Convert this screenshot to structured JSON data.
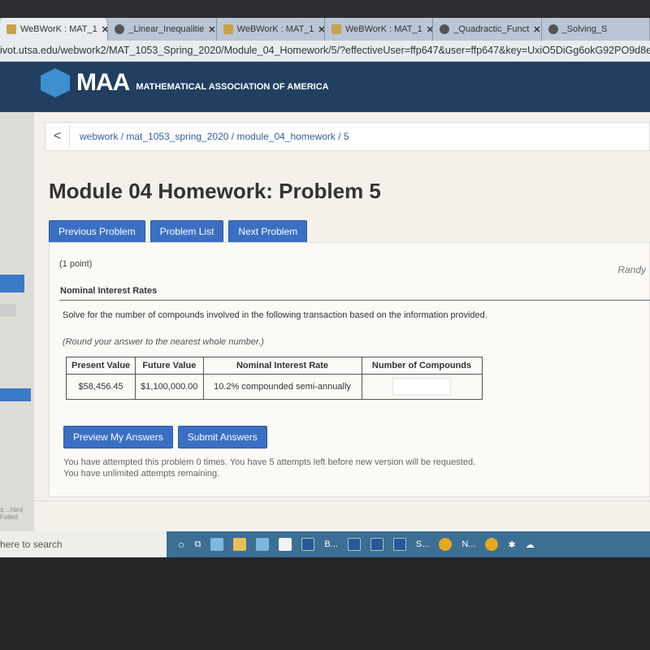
{
  "browser": {
    "tabs": [
      {
        "label": "WeBWorK : MAT_1",
        "icon": "webwork-icon",
        "active": true
      },
      {
        "label": "_Linear_Inequalitie",
        "icon": "globe-icon"
      },
      {
        "label": "WeBWorK : MAT_1",
        "icon": "webwork-icon"
      },
      {
        "label": "WeBWorK : MAT_1",
        "icon": "webwork-icon"
      },
      {
        "label": "_Quadractic_Funct",
        "icon": "globe-icon"
      },
      {
        "label": "_Solving_S",
        "icon": "globe-icon"
      }
    ],
    "close_glyph": "✕",
    "url": "ivot.utsa.edu/webwork2/MAT_1053_Spring_2020/Module_04_Homework/5/?effectiveUser=ffp647&user=ffp647&key=UxiO5DiGg6okG92PO9d8e"
  },
  "header": {
    "logo": "MAA",
    "org": "MATHEMATICAL ASSOCIATION OF AMERICA"
  },
  "breadcrumb": "webwork / mat_1053_spring_2020 / module_04_homework / 5",
  "back_glyph": "<",
  "title": "Module 04 Homework: Problem 5",
  "nav": {
    "prev": "Previous Problem",
    "list": "Problem List",
    "next": "Next Problem"
  },
  "problem": {
    "points": "(1 point)",
    "user": "Randy",
    "heading": "Nominal Interest Rates",
    "instruction": "Solve for the number of compounds involved in the following transaction based on the information provided.",
    "rounding": "(Round your answer to the nearest whole number.)",
    "table": {
      "headers": [
        "Present Value",
        "Future Value",
        "Nominal Interest Rate",
        "Number of Compounds"
      ],
      "row": [
        "$58,456.45",
        "$1,100,000.00",
        "10.2% compounded semi-annually",
        ""
      ]
    }
  },
  "actions": {
    "preview": "Preview My Answers",
    "submit": "Submit Answers"
  },
  "attempts": [
    "You have attempted this problem 0 times. You have 5 attempts left before new version will be requested.",
    "You have unlimited attempts remaining."
  ],
  "download": {
    "file": "s....html",
    "status": "Failed"
  },
  "taskbar": {
    "search": "here to search",
    "items": [
      "B...",
      "",
      "",
      "S...",
      "N..."
    ]
  },
  "colors": {
    "header": "#223f62",
    "button": "#3a6fc4",
    "taskbar": "#3b6f93"
  }
}
